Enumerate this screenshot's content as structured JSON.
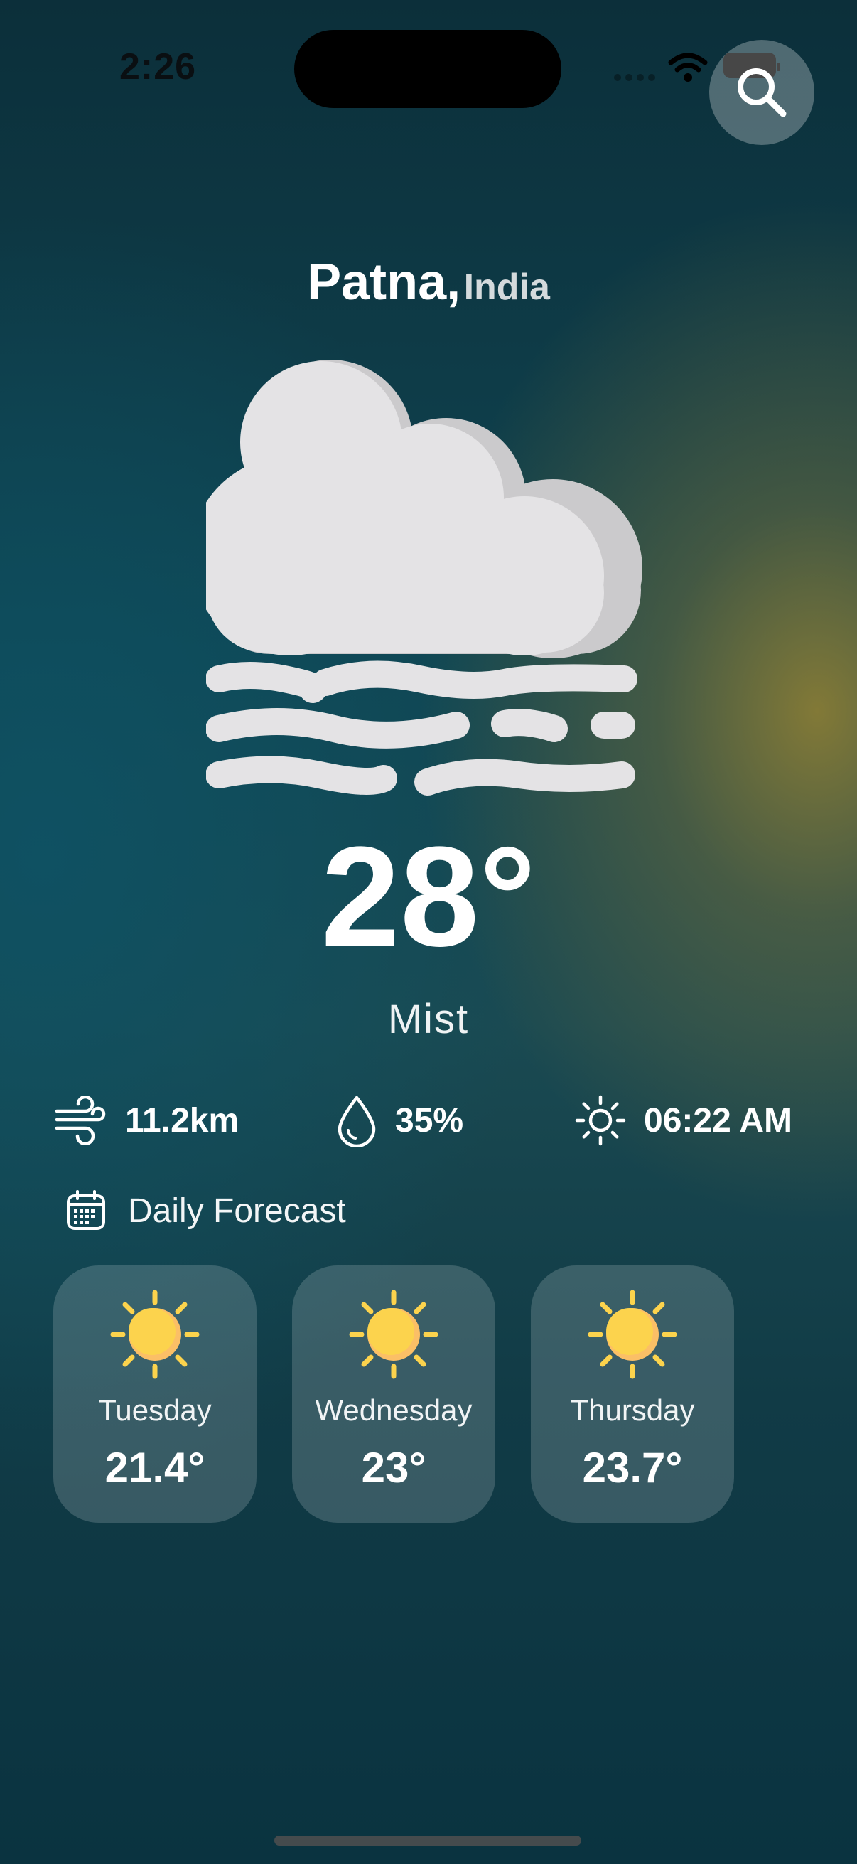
{
  "status_bar": {
    "time": "2:26"
  },
  "search": {
    "icon": "search-icon"
  },
  "location": {
    "city": "Patna,",
    "country": "India"
  },
  "current": {
    "icon": "mist-icon",
    "temperature": "28°",
    "condition": "Mist"
  },
  "stats": {
    "wind": {
      "icon": "wind-icon",
      "value": "11.2km"
    },
    "humidity": {
      "icon": "droplet-icon",
      "value": "35%"
    },
    "sunrise": {
      "icon": "sun-outline-icon",
      "value": "06:22 AM"
    }
  },
  "forecast": {
    "icon": "calendar-icon",
    "title": "Daily Forecast",
    "days": [
      {
        "day": "Tuesday",
        "temp": "21.4°",
        "icon": "sun-icon"
      },
      {
        "day": "Wednesday",
        "temp": "23°",
        "icon": "sun-icon"
      },
      {
        "day": "Thursday",
        "temp": "23.7°",
        "icon": "sun-icon"
      }
    ]
  },
  "colors": {
    "sun": "#FCD34D",
    "sun_shade": "#FBBF66",
    "cloud": "#E4E3E5",
    "cloud_shade": "#CBCACC"
  }
}
